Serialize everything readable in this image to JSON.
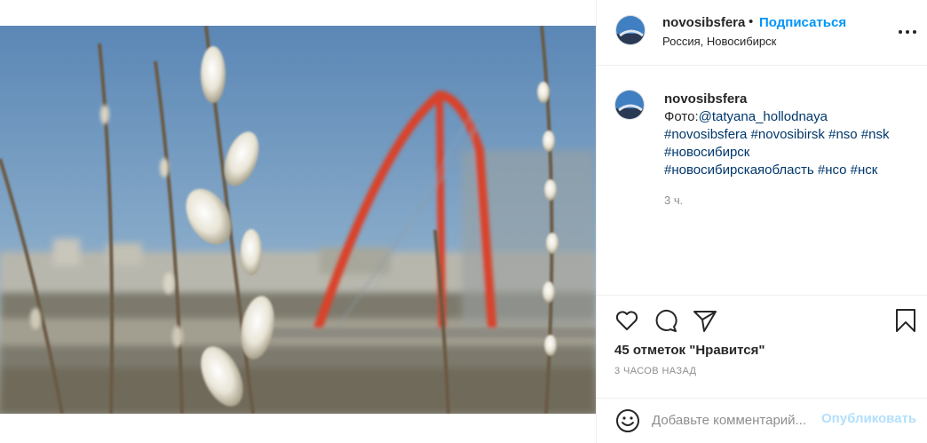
{
  "post": {
    "username": "novosibsfera",
    "follow_label": "Подписаться",
    "location": "Россия, Новосибирск",
    "dot": "•"
  },
  "caption": {
    "username": "novosibsfera",
    "line1_prefix": "Фото:",
    "line1_mention": "@tatyana_hollodnaya",
    "line2": "#novosibsfera #novosibirsk #nso #nsk",
    "line3": "#новосибирск",
    "line4": "#новосибирскаяобласть #нсо #нск",
    "time": "3 ч."
  },
  "engagement": {
    "likes": "45 отметок \"Нравится\"",
    "posted_ago": "3 ЧАСОВ НАЗАД"
  },
  "comment": {
    "placeholder": "Добавьте комментарий...",
    "publish_label": "Опубликовать"
  },
  "icons": [
    "more-icon",
    "heart-icon",
    "comment-icon",
    "share-icon",
    "bookmark-icon",
    "emoji-icon"
  ],
  "colors": {
    "accent": "#0095f6",
    "publish_disabled": "#b2dffc",
    "hashtag": "#00376b",
    "muted": "#8e8e8e"
  }
}
